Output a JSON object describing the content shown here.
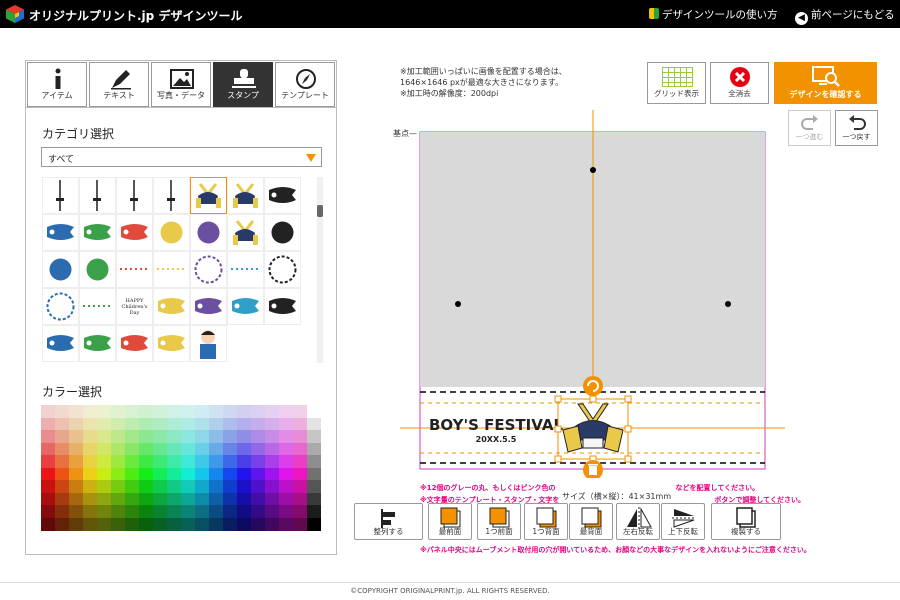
{
  "header": {
    "brand": "オリジナルプリント.jp デザインツール",
    "howto": "デザインツールの使い方",
    "back": "前ページにもどる"
  },
  "tabs": [
    {
      "label": "アイテム",
      "icon": "info-icon",
      "active": false
    },
    {
      "label": "テキスト",
      "icon": "pen-icon",
      "active": false
    },
    {
      "label": "写真・データ",
      "icon": "image-icon",
      "active": false
    },
    {
      "label": "スタンプ",
      "icon": "stamp-icon",
      "active": true
    },
    {
      "label": "テンプレート",
      "icon": "compass-icon",
      "active": false
    }
  ],
  "category": {
    "label": "カテゴリ選択",
    "selected": "すべて"
  },
  "stamps": [
    "sword",
    "bow",
    "arrow",
    "katana",
    "kabuto",
    "kabuto-armor",
    "koinobori-black",
    "koinobori-green",
    "koinobori-blue",
    "koinobori-red",
    "mizuhiki",
    "rising-sun",
    "kabuto-gold",
    "wave-blue",
    "kimono-purple",
    "wave-green",
    "dotted-line",
    "dotted-line-2",
    "flower-wreath",
    "bunting",
    "frame-blue",
    "frame-green",
    "border-blue",
    "childrens-day-text",
    "koinobori-pole",
    "koinobori-stripes",
    "koinobori-small-blue",
    "koinobori-small-blue-2",
    "koinobori-small-red",
    "koinobori-small-green",
    "koinobori-small-blue-3",
    "koinobori-small-red-2",
    "boy-doll"
  ],
  "childrens_day_text": "HAPPY Children's Day",
  "color": {
    "label": "カラー選択"
  },
  "notes": {
    "line1": "※加工範囲いっぱいに画像を配置する場合は、",
    "line2": "1646×1646 pxが最適な大きさになります。",
    "line3": "※加工時の解像度：200dpi"
  },
  "toolbar": {
    "grid": "グリッド表示",
    "clear": "全消去",
    "confirm": "デザインを確認する",
    "redo": "一つ進む",
    "undo": "一つ戻す"
  },
  "canvas": {
    "origin": "基点",
    "title": "BOY'S FESTIVAL",
    "date": "20XX.5.5",
    "size_label": "サイズ（横×縦）：41×31mm"
  },
  "red_notes": {
    "line1": "※12個のグレーの丸、もしくはピンク色の",
    "line1b": "などを配置してください。",
    "line2": "※文字量のテンプレート・スタンプ・文字を",
    "line2b": "ボタンで調整してください。",
    "line3": "※パネル中央にはムーブメント取付用の穴が開いているため、お顔などの大事なデザインを入れないようにご注意ください。"
  },
  "tools": [
    {
      "label": "整列する",
      "name": "align-button"
    },
    {
      "label": "最前面",
      "name": "bring-front-button"
    },
    {
      "label": "1つ前面",
      "name": "bring-forward-button"
    },
    {
      "label": "1つ背面",
      "name": "send-backward-button"
    },
    {
      "label": "最背面",
      "name": "send-back-button"
    },
    {
      "label": "左右反転",
      "name": "flip-horizontal-button"
    },
    {
      "label": "上下反転",
      "name": "flip-vertical-button"
    },
    {
      "label": "複製する",
      "name": "duplicate-button"
    }
  ],
  "footer": "©COPYRIGHT ORIGINALPRINT.jp. ALL RIGHTS RESERVED.",
  "colors": {
    "accent": "#f29200",
    "guide_purple": "#c83cc8",
    "note_red": "#e4007f",
    "header_bg": "#000000"
  }
}
